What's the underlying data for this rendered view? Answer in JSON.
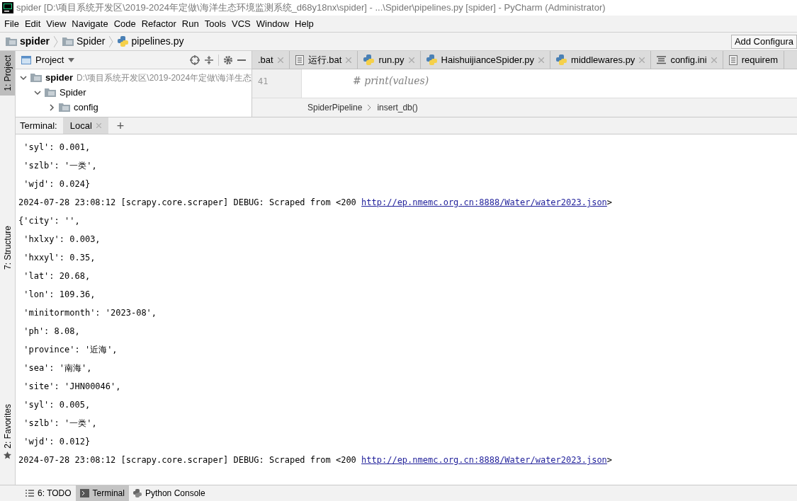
{
  "window": {
    "title": "spider [D:\\项目系统开发区\\2019-2024年定做\\海洋生态环境监测系统_d68y18nx\\spider] - ...\\Spider\\pipelines.py [spider] - PyCharm (Administrator)"
  },
  "menu": [
    "File",
    "Edit",
    "View",
    "Navigate",
    "Code",
    "Refactor",
    "Run",
    "Tools",
    "VCS",
    "Window",
    "Help"
  ],
  "breadcrumb": [
    {
      "label": "spider",
      "kind": "folder"
    },
    {
      "label": "Spider",
      "kind": "folder"
    },
    {
      "label": "pipelines.py",
      "kind": "python"
    }
  ],
  "run_config": {
    "label": "Add Configura"
  },
  "left_strip": [
    {
      "label": "1: Project",
      "selected": true
    },
    {
      "label": "7: Structure",
      "selected": false
    },
    {
      "label": "2: Favorites",
      "selected": false
    }
  ],
  "project_panel": {
    "title": "Project",
    "tree": [
      {
        "label": "spider",
        "path": "D:\\项目系统开发区\\2019-2024年定做\\海洋生态",
        "expanded": true,
        "children": [
          {
            "label": "Spider",
            "expanded": true,
            "children": [
              {
                "label": "config",
                "expanded": false
              }
            ]
          }
        ]
      }
    ]
  },
  "editor_tabs": [
    {
      "label": ".bat",
      "selected": false
    },
    {
      "label": "运行.bat",
      "kind": "text",
      "selected": false
    },
    {
      "label": "run.py",
      "kind": "python",
      "selected": false
    },
    {
      "label": "HaishuijianceSpider.py",
      "kind": "python",
      "selected": false
    },
    {
      "label": "middlewares.py",
      "kind": "python",
      "selected": false
    },
    {
      "label": "config.ini",
      "kind": "ini",
      "selected": false
    },
    {
      "label": "requirem",
      "kind": "text",
      "selected": false
    }
  ],
  "editor": {
    "line_number": "41",
    "code": "# print(values)",
    "crumbs": [
      "SpiderPipeline",
      "insert_db()"
    ]
  },
  "terminal": {
    "label": "Terminal:",
    "tabs": [
      {
        "label": "Local",
        "selected": true
      }
    ],
    "add": "+",
    "lines": [
      {
        "kind": "plain",
        "text": " 'syl': 0.001,"
      },
      {
        "kind": "plain",
        "text": " 'szlb': '一类',"
      },
      {
        "kind": "plain",
        "text": " 'wjd': 0.024}"
      },
      {
        "kind": "log",
        "text": "2024-07-28 23:08:12 [scrapy.core.scraper] DEBUG: Scraped from <200 ",
        "link": "http://ep.nmemc.org.cn:8888/Water/water2023.json",
        "suffix": ">"
      },
      {
        "kind": "plain",
        "text": "{'city': '',"
      },
      {
        "kind": "plain",
        "text": " 'hxlxy': 0.003,"
      },
      {
        "kind": "plain",
        "text": " 'hxxyl': 0.35,"
      },
      {
        "kind": "plain",
        "text": " 'lat': 20.68,"
      },
      {
        "kind": "plain",
        "text": " 'lon': 109.36,"
      },
      {
        "kind": "plain",
        "text": " 'minitormonth': '2023-08',"
      },
      {
        "kind": "plain",
        "text": " 'ph': 8.08,"
      },
      {
        "kind": "plain",
        "text": " 'province': '近海',"
      },
      {
        "kind": "plain",
        "text": " 'sea': '南海',"
      },
      {
        "kind": "plain",
        "text": " 'site': 'JHN00046',"
      },
      {
        "kind": "plain",
        "text": " 'syl': 0.005,"
      },
      {
        "kind": "plain",
        "text": " 'szlb': '一类',"
      },
      {
        "kind": "plain",
        "text": " 'wjd': 0.012}"
      },
      {
        "kind": "log",
        "text": "2024-07-28 23:08:12 [scrapy.core.scraper] DEBUG: Scraped from <200 ",
        "link": "http://ep.nmemc.org.cn:8888/Water/water2023.json",
        "suffix": ">"
      }
    ]
  },
  "bottom_tabs": [
    {
      "label": "6: TODO",
      "kind": "todo",
      "selected": false
    },
    {
      "label": "Terminal",
      "kind": "terminal",
      "selected": true
    },
    {
      "label": "Python Console",
      "kind": "python",
      "selected": false
    }
  ]
}
